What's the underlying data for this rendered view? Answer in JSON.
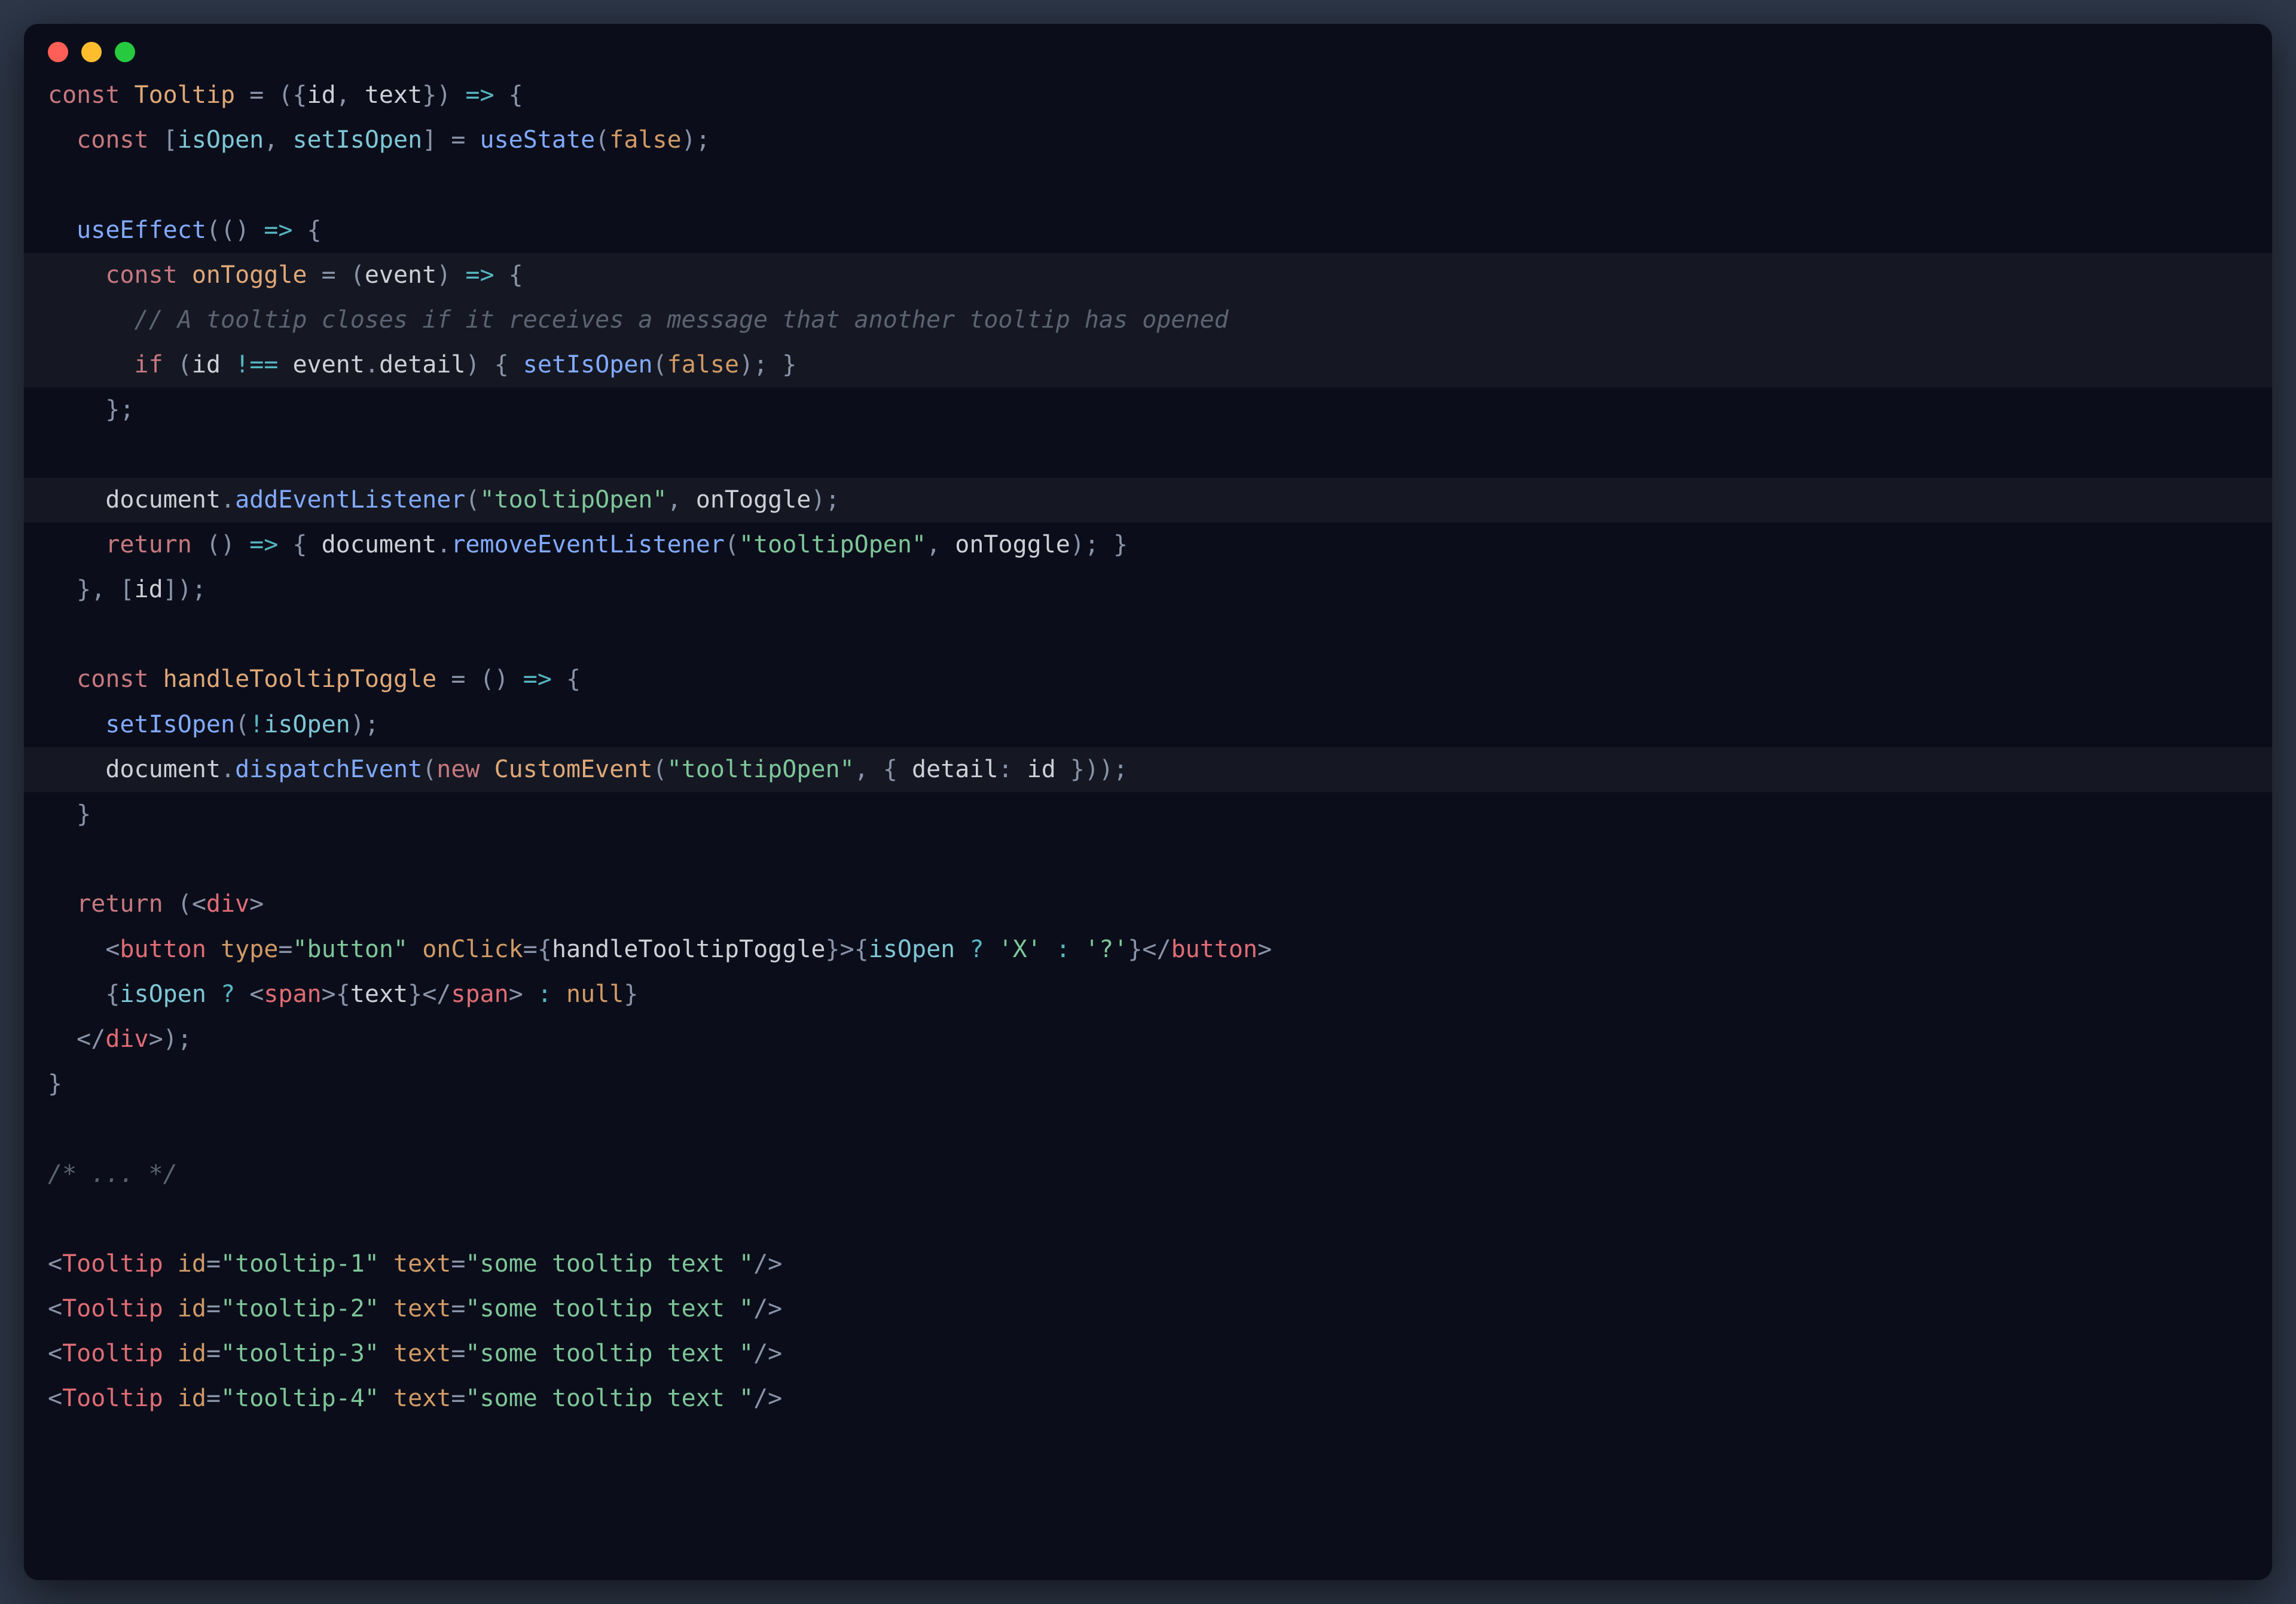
{
  "window": {
    "traffic_lights": [
      "close",
      "minimize",
      "zoom"
    ]
  },
  "code": {
    "lines": [
      {
        "hl": false,
        "tokens": [
          {
            "c": "k",
            "t": "const "
          },
          {
            "c": "fnname",
            "t": "Tooltip"
          },
          {
            "c": "punc",
            "t": " = ({"
          },
          {
            "c": "param",
            "t": "id"
          },
          {
            "c": "punc",
            "t": ", "
          },
          {
            "c": "param",
            "t": "text"
          },
          {
            "c": "punc",
            "t": "}) "
          },
          {
            "c": "op",
            "t": "=>"
          },
          {
            "c": "punc",
            "t": " {"
          }
        ]
      },
      {
        "hl": false,
        "tokens": [
          {
            "c": "punc",
            "t": "  "
          },
          {
            "c": "k",
            "t": "const "
          },
          {
            "c": "punc",
            "t": "["
          },
          {
            "c": "id",
            "t": "isOpen"
          },
          {
            "c": "punc",
            "t": ", "
          },
          {
            "c": "id",
            "t": "setIsOpen"
          },
          {
            "c": "punc",
            "t": "] = "
          },
          {
            "c": "fn",
            "t": "useState"
          },
          {
            "c": "punc",
            "t": "("
          },
          {
            "c": "bool",
            "t": "false"
          },
          {
            "c": "punc",
            "t": ");"
          }
        ]
      },
      {
        "hl": false,
        "tokens": []
      },
      {
        "hl": false,
        "tokens": [
          {
            "c": "punc",
            "t": "  "
          },
          {
            "c": "fn",
            "t": "useEffect"
          },
          {
            "c": "punc",
            "t": "(() "
          },
          {
            "c": "op",
            "t": "=>"
          },
          {
            "c": "punc",
            "t": " {"
          }
        ]
      },
      {
        "hl": true,
        "tokens": [
          {
            "c": "punc",
            "t": "    "
          },
          {
            "c": "k",
            "t": "const "
          },
          {
            "c": "fnname",
            "t": "onToggle"
          },
          {
            "c": "punc",
            "t": " = ("
          },
          {
            "c": "param",
            "t": "event"
          },
          {
            "c": "punc",
            "t": ") "
          },
          {
            "c": "op",
            "t": "=>"
          },
          {
            "c": "punc",
            "t": " {"
          }
        ]
      },
      {
        "hl": true,
        "tokens": [
          {
            "c": "punc",
            "t": "      "
          },
          {
            "c": "cmt",
            "t": "// A tooltip closes if it receives a message that another tooltip has opened"
          }
        ]
      },
      {
        "hl": true,
        "tokens": [
          {
            "c": "punc",
            "t": "      "
          },
          {
            "c": "k",
            "t": "if "
          },
          {
            "c": "punc",
            "t": "("
          },
          {
            "c": "param",
            "t": "id"
          },
          {
            "c": "punc",
            "t": " "
          },
          {
            "c": "op",
            "t": "!=="
          },
          {
            "c": "punc",
            "t": " "
          },
          {
            "c": "param",
            "t": "event"
          },
          {
            "c": "punc",
            "t": "."
          },
          {
            "c": "param",
            "t": "detail"
          },
          {
            "c": "punc",
            "t": ") { "
          },
          {
            "c": "fn",
            "t": "setIsOpen"
          },
          {
            "c": "punc",
            "t": "("
          },
          {
            "c": "bool",
            "t": "false"
          },
          {
            "c": "punc",
            "t": "); }"
          }
        ]
      },
      {
        "hl": false,
        "tokens": [
          {
            "c": "punc",
            "t": "    };"
          }
        ]
      },
      {
        "hl": false,
        "tokens": []
      },
      {
        "hl": true,
        "tokens": [
          {
            "c": "punc",
            "t": "    "
          },
          {
            "c": "param",
            "t": "document"
          },
          {
            "c": "punc",
            "t": "."
          },
          {
            "c": "fn",
            "t": "addEventListener"
          },
          {
            "c": "punc",
            "t": "("
          },
          {
            "c": "str",
            "t": "\"tooltipOpen\""
          },
          {
            "c": "punc",
            "t": ", "
          },
          {
            "c": "param",
            "t": "onToggle"
          },
          {
            "c": "punc",
            "t": ");"
          }
        ]
      },
      {
        "hl": false,
        "tokens": [
          {
            "c": "punc",
            "t": "    "
          },
          {
            "c": "k",
            "t": "return "
          },
          {
            "c": "punc",
            "t": "() "
          },
          {
            "c": "op",
            "t": "=>"
          },
          {
            "c": "punc",
            "t": " { "
          },
          {
            "c": "param",
            "t": "document"
          },
          {
            "c": "punc",
            "t": "."
          },
          {
            "c": "fn",
            "t": "removeEventListener"
          },
          {
            "c": "punc",
            "t": "("
          },
          {
            "c": "str",
            "t": "\"tooltipOpen\""
          },
          {
            "c": "punc",
            "t": ", "
          },
          {
            "c": "param",
            "t": "onToggle"
          },
          {
            "c": "punc",
            "t": "); }"
          }
        ]
      },
      {
        "hl": false,
        "tokens": [
          {
            "c": "punc",
            "t": "  }, ["
          },
          {
            "c": "param",
            "t": "id"
          },
          {
            "c": "punc",
            "t": "]);"
          }
        ]
      },
      {
        "hl": false,
        "tokens": []
      },
      {
        "hl": false,
        "tokens": [
          {
            "c": "punc",
            "t": "  "
          },
          {
            "c": "k",
            "t": "const "
          },
          {
            "c": "fnname",
            "t": "handleTooltipToggle"
          },
          {
            "c": "punc",
            "t": " = () "
          },
          {
            "c": "op",
            "t": "=>"
          },
          {
            "c": "punc",
            "t": " {"
          }
        ]
      },
      {
        "hl": false,
        "tokens": [
          {
            "c": "punc",
            "t": "    "
          },
          {
            "c": "fn",
            "t": "setIsOpen"
          },
          {
            "c": "punc",
            "t": "("
          },
          {
            "c": "op",
            "t": "!"
          },
          {
            "c": "id",
            "t": "isOpen"
          },
          {
            "c": "punc",
            "t": ");"
          }
        ]
      },
      {
        "hl": true,
        "tokens": [
          {
            "c": "punc",
            "t": "    "
          },
          {
            "c": "param",
            "t": "document"
          },
          {
            "c": "punc",
            "t": "."
          },
          {
            "c": "fn",
            "t": "dispatchEvent"
          },
          {
            "c": "punc",
            "t": "("
          },
          {
            "c": "k",
            "t": "new "
          },
          {
            "c": "fnname",
            "t": "CustomEvent"
          },
          {
            "c": "punc",
            "t": "("
          },
          {
            "c": "str",
            "t": "\"tooltipOpen\""
          },
          {
            "c": "punc",
            "t": ", { "
          },
          {
            "c": "param",
            "t": "detail"
          },
          {
            "c": "punc",
            "t": ": "
          },
          {
            "c": "param",
            "t": "id"
          },
          {
            "c": "punc",
            "t": " }));"
          }
        ]
      },
      {
        "hl": false,
        "tokens": [
          {
            "c": "punc",
            "t": "  }"
          }
        ]
      },
      {
        "hl": false,
        "tokens": []
      },
      {
        "hl": false,
        "tokens": [
          {
            "c": "punc",
            "t": "  "
          },
          {
            "c": "k",
            "t": "return "
          },
          {
            "c": "punc",
            "t": "(<"
          },
          {
            "c": "tag",
            "t": "div"
          },
          {
            "c": "punc",
            "t": ">"
          }
        ]
      },
      {
        "hl": false,
        "tokens": [
          {
            "c": "punc",
            "t": "    <"
          },
          {
            "c": "tag",
            "t": "button"
          },
          {
            "c": "punc",
            "t": " "
          },
          {
            "c": "attr",
            "t": "type"
          },
          {
            "c": "punc",
            "t": "="
          },
          {
            "c": "str",
            "t": "\"button\""
          },
          {
            "c": "punc",
            "t": " "
          },
          {
            "c": "attr",
            "t": "onClick"
          },
          {
            "c": "punc",
            "t": "={"
          },
          {
            "c": "param",
            "t": "handleTooltipToggle"
          },
          {
            "c": "punc",
            "t": "}>{"
          },
          {
            "c": "id",
            "t": "isOpen"
          },
          {
            "c": "punc",
            "t": " "
          },
          {
            "c": "op",
            "t": "?"
          },
          {
            "c": "punc",
            "t": " "
          },
          {
            "c": "str",
            "t": "'X'"
          },
          {
            "c": "punc",
            "t": " "
          },
          {
            "c": "op",
            "t": ":"
          },
          {
            "c": "punc",
            "t": " "
          },
          {
            "c": "str",
            "t": "'?'"
          },
          {
            "c": "punc",
            "t": "}</"
          },
          {
            "c": "tag",
            "t": "button"
          },
          {
            "c": "punc",
            "t": ">"
          }
        ]
      },
      {
        "hl": false,
        "tokens": [
          {
            "c": "punc",
            "t": "    {"
          },
          {
            "c": "id",
            "t": "isOpen"
          },
          {
            "c": "punc",
            "t": " "
          },
          {
            "c": "op",
            "t": "?"
          },
          {
            "c": "punc",
            "t": " <"
          },
          {
            "c": "tag",
            "t": "span"
          },
          {
            "c": "punc",
            "t": ">{"
          },
          {
            "c": "param",
            "t": "text"
          },
          {
            "c": "punc",
            "t": "}</"
          },
          {
            "c": "tag",
            "t": "span"
          },
          {
            "c": "punc",
            "t": "> "
          },
          {
            "c": "op",
            "t": ":"
          },
          {
            "c": "punc",
            "t": " "
          },
          {
            "c": "bool",
            "t": "null"
          },
          {
            "c": "punc",
            "t": "}"
          }
        ]
      },
      {
        "hl": false,
        "tokens": [
          {
            "c": "punc",
            "t": "  </"
          },
          {
            "c": "tag",
            "t": "div"
          },
          {
            "c": "punc",
            "t": ">);"
          }
        ]
      },
      {
        "hl": false,
        "tokens": [
          {
            "c": "punc",
            "t": "}"
          }
        ]
      },
      {
        "hl": false,
        "tokens": []
      },
      {
        "hl": false,
        "tokens": [
          {
            "c": "cmt",
            "t": "/* ... */"
          }
        ]
      },
      {
        "hl": false,
        "tokens": []
      },
      {
        "hl": false,
        "tokens": [
          {
            "c": "punc",
            "t": "<"
          },
          {
            "c": "tag",
            "t": "Tooltip"
          },
          {
            "c": "punc",
            "t": " "
          },
          {
            "c": "attr",
            "t": "id"
          },
          {
            "c": "punc",
            "t": "="
          },
          {
            "c": "str",
            "t": "\"tooltip-1\""
          },
          {
            "c": "punc",
            "t": " "
          },
          {
            "c": "attr",
            "t": "text"
          },
          {
            "c": "punc",
            "t": "="
          },
          {
            "c": "str",
            "t": "\"some tooltip text \""
          },
          {
            "c": "punc",
            "t": "/>"
          }
        ]
      },
      {
        "hl": false,
        "tokens": [
          {
            "c": "punc",
            "t": "<"
          },
          {
            "c": "tag",
            "t": "Tooltip"
          },
          {
            "c": "punc",
            "t": " "
          },
          {
            "c": "attr",
            "t": "id"
          },
          {
            "c": "punc",
            "t": "="
          },
          {
            "c": "str",
            "t": "\"tooltip-2\""
          },
          {
            "c": "punc",
            "t": " "
          },
          {
            "c": "attr",
            "t": "text"
          },
          {
            "c": "punc",
            "t": "="
          },
          {
            "c": "str",
            "t": "\"some tooltip text \""
          },
          {
            "c": "punc",
            "t": "/>"
          }
        ]
      },
      {
        "hl": false,
        "tokens": [
          {
            "c": "punc",
            "t": "<"
          },
          {
            "c": "tag",
            "t": "Tooltip"
          },
          {
            "c": "punc",
            "t": " "
          },
          {
            "c": "attr",
            "t": "id"
          },
          {
            "c": "punc",
            "t": "="
          },
          {
            "c": "str",
            "t": "\"tooltip-3\""
          },
          {
            "c": "punc",
            "t": " "
          },
          {
            "c": "attr",
            "t": "text"
          },
          {
            "c": "punc",
            "t": "="
          },
          {
            "c": "str",
            "t": "\"some tooltip text \""
          },
          {
            "c": "punc",
            "t": "/>"
          }
        ]
      },
      {
        "hl": false,
        "tokens": [
          {
            "c": "punc",
            "t": "<"
          },
          {
            "c": "tag",
            "t": "Tooltip"
          },
          {
            "c": "punc",
            "t": " "
          },
          {
            "c": "attr",
            "t": "id"
          },
          {
            "c": "punc",
            "t": "="
          },
          {
            "c": "str",
            "t": "\"tooltip-4\""
          },
          {
            "c": "punc",
            "t": " "
          },
          {
            "c": "attr",
            "t": "text"
          },
          {
            "c": "punc",
            "t": "="
          },
          {
            "c": "str",
            "t": "\"some tooltip text \""
          },
          {
            "c": "punc",
            "t": "/>"
          }
        ]
      }
    ]
  }
}
